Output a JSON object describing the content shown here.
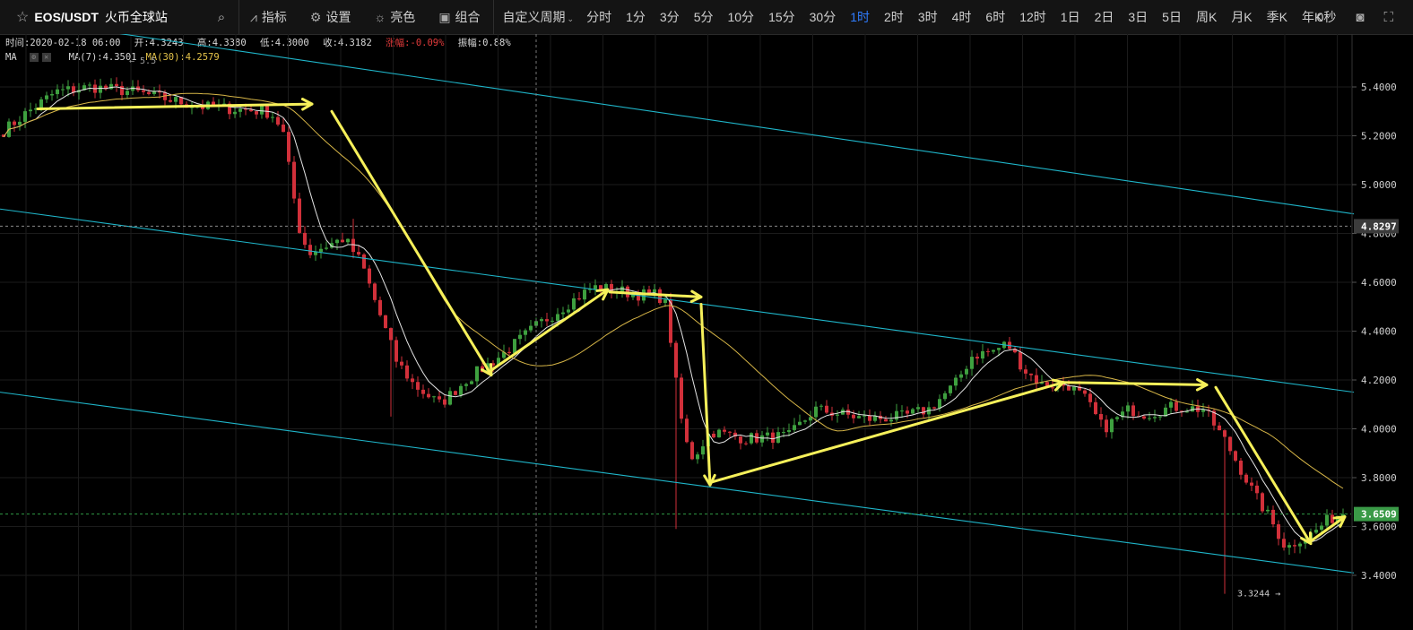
{
  "toolbar": {
    "symbol": "EOS/USDT",
    "exchange": "火币全球站",
    "indicators_label": "指标",
    "settings_label": "设置",
    "theme_label": "亮色",
    "combo_label": "组合",
    "custom_period_label": "自定义周期",
    "periods": [
      "分时",
      "1分",
      "3分",
      "5分",
      "10分",
      "15分",
      "30分",
      "1时",
      "2时",
      "3时",
      "4时",
      "6时",
      "12时",
      "1日",
      "2日",
      "3日",
      "5日",
      "周K",
      "月K",
      "季K",
      "年K"
    ],
    "active_period": "1时",
    "countdown": "0秒"
  },
  "info": {
    "time": "时间:2020-02-18 06:00",
    "open": "开:4.3243",
    "high": "高:4.3380",
    "low": "低:4.3000",
    "close": "收:4.3182",
    "change": "涨幅:-0.09%",
    "amplitude": "振幅:0.88%"
  },
  "ma_legend": {
    "label": "MA",
    "ma7": "MA(7):4.3501",
    "ma30": "MA(30):4.2579"
  },
  "colors": {
    "up": "#3ea03f",
    "down": "#d1303a",
    "ma7": "#e4e4e4",
    "ma30": "#d6b547",
    "channel": "#1fb5c9",
    "arrow": "#f6f05a",
    "price_tag_green": "#3a9a47",
    "price_tag_gray": "#3b3b3b"
  },
  "chart_data": {
    "type": "candlestick",
    "y_ticks": [
      "5.4000",
      "5.2000",
      "5.0000",
      "4.8000",
      "4.6000",
      "4.4000",
      "4.2000",
      "4.0000",
      "3.8000",
      "3.6000",
      "3.4000"
    ],
    "ylim": [
      3.225,
      5.6
    ],
    "crosshair_price": "4.8297",
    "current_price": "3.6509",
    "high_label": "← 5.5",
    "low_label": "3.3244 →",
    "candle_count": 250,
    "anchors": [
      [
        0,
        5.22
      ],
      [
        5,
        5.29
      ],
      [
        12,
        5.38
      ],
      [
        20,
        5.4
      ],
      [
        30,
        5.38
      ],
      [
        45,
        5.32
      ],
      [
        60,
        5.3
      ],
      [
        62,
        5.28
      ],
      [
        64,
        5.22
      ],
      [
        66,
        5.0
      ],
      [
        68,
        4.8
      ],
      [
        70,
        4.72
      ],
      [
        74,
        4.75
      ],
      [
        78,
        4.78
      ],
      [
        82,
        4.68
      ],
      [
        86,
        4.48
      ],
      [
        90,
        4.28
      ],
      [
        94,
        4.18
      ],
      [
        100,
        4.1
      ],
      [
        106,
        4.2
      ],
      [
        114,
        4.3
      ],
      [
        122,
        4.42
      ],
      [
        130,
        4.52
      ],
      [
        135,
        4.58
      ],
      [
        140,
        4.57
      ],
      [
        145,
        4.55
      ],
      [
        150,
        4.55
      ],
      [
        152,
        4.5
      ],
      [
        154,
        4.2
      ],
      [
        156,
        3.96
      ],
      [
        158,
        3.88
      ],
      [
        162,
        3.99
      ],
      [
        170,
        3.96
      ],
      [
        180,
        3.97
      ],
      [
        186,
        4.08
      ],
      [
        192,
        4.06
      ],
      [
        198,
        4.04
      ],
      [
        206,
        4.05
      ],
      [
        212,
        4.08
      ],
      [
        218,
        4.18
      ],
      [
        222,
        4.3
      ],
      [
        227,
        4.32
      ],
      [
        230,
        4.35
      ],
      [
        234,
        4.24
      ],
      [
        238,
        4.18
      ],
      [
        244,
        4.18
      ],
      [
        248,
        4.12
      ],
      [
        252,
        4.0
      ],
      [
        258,
        4.08
      ],
      [
        262,
        4.06
      ],
      [
        268,
        4.09
      ],
      [
        275,
        4.08
      ],
      [
        280,
        3.95
      ],
      [
        284,
        3.82
      ],
      [
        287,
        3.72
      ],
      [
        290,
        3.64
      ],
      [
        294,
        3.51
      ],
      [
        297,
        3.55
      ],
      [
        300,
        3.57
      ],
      [
        303,
        3.62
      ],
      [
        307,
        3.66
      ]
    ],
    "channels": [
      {
        "name": "upper",
        "p1": [
          0,
          5.69
        ],
        "p2": [
          1510,
          4.88
        ]
      },
      {
        "name": "middle",
        "p1": [
          0,
          4.9
        ],
        "p2": [
          1510,
          4.15
        ]
      },
      {
        "name": "lower",
        "p1": [
          0,
          4.15
        ],
        "p2": [
          1510,
          3.41
        ]
      }
    ],
    "annotation_arrows": [
      [
        [
          42,
          5.31
        ],
        [
          348,
          5.33
        ]
      ],
      [
        [
          370,
          5.3
        ],
        [
          548,
          4.22
        ]
      ],
      [
        [
          548,
          4.24
        ],
        [
          678,
          4.57
        ]
      ],
      [
        [
          680,
          4.56
        ],
        [
          782,
          4.54
        ]
      ],
      [
        [
          782,
          4.51
        ],
        [
          792,
          3.77
        ]
      ],
      [
        [
          792,
          3.78
        ],
        [
          1186,
          4.19
        ]
      ],
      [
        [
          1186,
          4.19
        ],
        [
          1346,
          4.18
        ]
      ],
      [
        [
          1356,
          4.17
        ],
        [
          1462,
          3.53
        ]
      ],
      [
        [
          1462,
          3.54
        ],
        [
          1500,
          3.64
        ]
      ]
    ]
  }
}
